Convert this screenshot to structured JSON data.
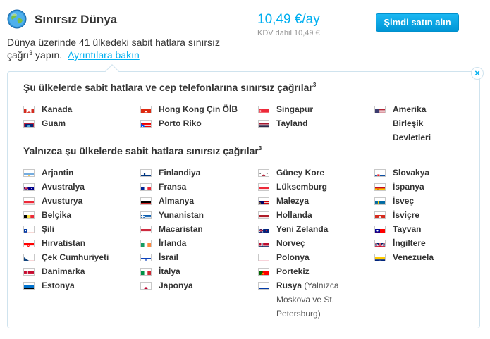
{
  "plan": {
    "title": "Sınırsız Dünya",
    "description_prefix": "Dünya üzerinde 41 ülkedeki sabit hatlara sınırsız çağrı",
    "description_sup": "3",
    "description_suffix": " yapın.",
    "details_link": "Ayrıntılara bakın",
    "price": "10,49 €/ay",
    "vat_note": "KDV dahil 10,49 €",
    "buy_button": "Şimdi satın alın"
  },
  "panel": {
    "close_glyph": "×",
    "section1": {
      "title": "Şu ülkelerde sabit hatlara ve cep telefonlarına sınırsız çağrılar",
      "sup": "3",
      "columns": [
        [
          {
            "name": "Kanada",
            "flag": "ca"
          },
          {
            "name": "Guam",
            "flag": "gu"
          }
        ],
        [
          {
            "name": "Hong Kong Çin ÖİB",
            "flag": "hk"
          },
          {
            "name": "Porto Riko",
            "flag": "pr"
          }
        ],
        [
          {
            "name": "Singapur",
            "flag": "sg"
          },
          {
            "name": "Tayland",
            "flag": "th"
          }
        ],
        [
          {
            "name": "Amerika Birleşik Devletleri",
            "flag": "us"
          }
        ]
      ]
    },
    "section2": {
      "title": "Yalnızca şu ülkelerde sabit hatlara sınırsız çağrılar",
      "sup": "3",
      "columns": [
        [
          {
            "name": "Arjantin",
            "flag": "ar"
          },
          {
            "name": "Avustralya",
            "flag": "au"
          },
          {
            "name": "Avusturya",
            "flag": "at"
          },
          {
            "name": "Belçika",
            "flag": "be"
          },
          {
            "name": "Şili",
            "flag": "cl"
          },
          {
            "name": "Hırvatistan",
            "flag": "hr"
          },
          {
            "name": "Çek Cumhuriyeti",
            "flag": "cz"
          },
          {
            "name": "Danimarka",
            "flag": "dk"
          },
          {
            "name": "Estonya",
            "flag": "ee"
          }
        ],
        [
          {
            "name": "Finlandiya",
            "flag": "fi"
          },
          {
            "name": "Fransa",
            "flag": "fr"
          },
          {
            "name": "Almanya",
            "flag": "de"
          },
          {
            "name": "Yunanistan",
            "flag": "gr"
          },
          {
            "name": "Macaristan",
            "flag": "hu"
          },
          {
            "name": "İrlanda",
            "flag": "ie"
          },
          {
            "name": "İsrail",
            "flag": "il"
          },
          {
            "name": "İtalya",
            "flag": "it"
          },
          {
            "name": "Japonya",
            "flag": "jp"
          }
        ],
        [
          {
            "name": "Güney Kore",
            "flag": "kr"
          },
          {
            "name": "Lüksemburg",
            "flag": "lu"
          },
          {
            "name": "Malezya",
            "flag": "my"
          },
          {
            "name": "Hollanda",
            "flag": "nl"
          },
          {
            "name": "Yeni Zelanda",
            "flag": "nz"
          },
          {
            "name": "Norveç",
            "flag": "no"
          },
          {
            "name": "Polonya",
            "flag": "pl"
          },
          {
            "name": "Portekiz",
            "flag": "pt"
          },
          {
            "name": "Rusya",
            "note": "(Yalnızca Moskova ve St. Petersburg)",
            "flag": "ru"
          }
        ],
        [
          {
            "name": "Slovakya",
            "flag": "sk"
          },
          {
            "name": "İspanya",
            "flag": "es"
          },
          {
            "name": "İsveç",
            "flag": "se"
          },
          {
            "name": "İsviçre",
            "flag": "ch"
          },
          {
            "name": "Tayvan",
            "flag": "tw"
          },
          {
            "name": "İngiltere",
            "flag": "gb"
          },
          {
            "name": "Venezuela",
            "flag": "ve"
          }
        ]
      ]
    }
  },
  "colors": {
    "accent": "#00aff0",
    "button": "#0aa3e4",
    "border": "#cfe3ee"
  }
}
